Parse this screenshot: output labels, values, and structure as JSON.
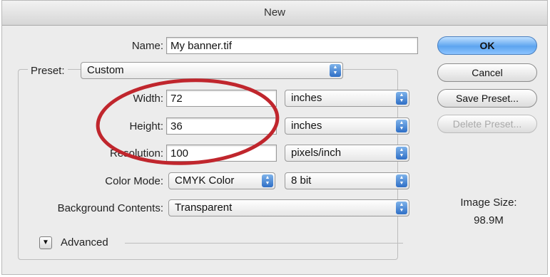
{
  "window": {
    "title": "New"
  },
  "form": {
    "name_label": "Name:",
    "name_value": "My banner.tif",
    "preset_label": "Preset:",
    "preset_value": "Custom",
    "width_label": "Width:",
    "width_value": "72",
    "width_unit": "inches",
    "height_label": "Height:",
    "height_value": "36",
    "height_unit": "inches",
    "resolution_label": "Resolution:",
    "resolution_value": "100",
    "resolution_unit": "pixels/inch",
    "color_mode_label": "Color Mode:",
    "color_mode_value": "CMYK Color",
    "bit_depth_value": "8 bit",
    "background_label": "Background Contents:",
    "background_value": "Transparent",
    "advanced_label": "Advanced"
  },
  "buttons": {
    "ok": "OK",
    "cancel": "Cancel",
    "save_preset": "Save Preset...",
    "delete_preset": "Delete Preset..."
  },
  "image_size": {
    "label": "Image Size:",
    "value": "98.9M"
  },
  "annotation": {
    "color": "#c0262d"
  }
}
